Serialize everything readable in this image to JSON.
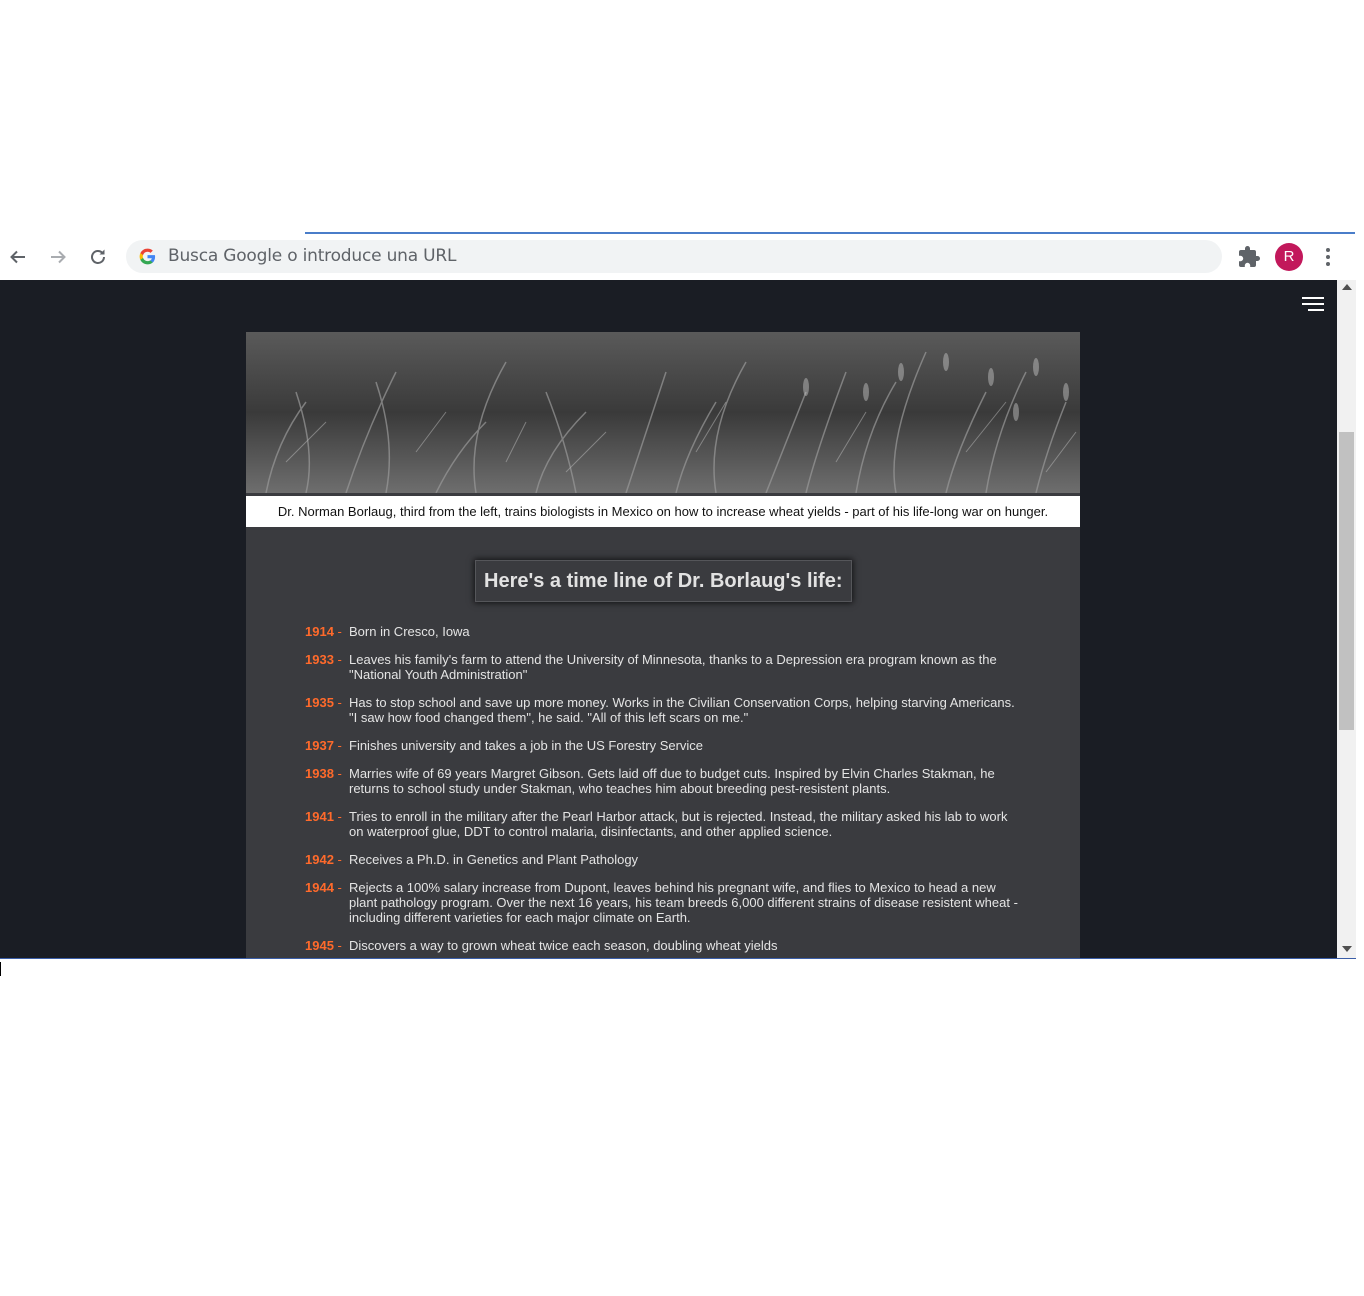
{
  "browser": {
    "omnibox_placeholder": "Busca Google o introduce una URL",
    "avatar_letter": "R",
    "accent_color": "#c2185b"
  },
  "page": {
    "caption": "Dr. Norman Borlaug, third from the left, trains biologists in Mexico on how to increase wheat yields - part of his life-long war on hunger.",
    "heading": "Here's a time line of Dr. Borlaug's life:",
    "year_color": "#ff6a2b",
    "events": [
      {
        "year": "1914",
        "text": "Born in Cresco, Iowa"
      },
      {
        "year": "1933",
        "text": "Leaves his family's farm to attend the University of Minnesota, thanks to a Depression era program known as the \"National Youth Administration\""
      },
      {
        "year": "1935",
        "text": "Has to stop school and save up more money. Works in the Civilian Conservation Corps, helping starving Americans. \"I saw how food changed them\", he said. \"All of this left scars on me.\""
      },
      {
        "year": "1937",
        "text": "Finishes university and takes a job in the US Forestry Service"
      },
      {
        "year": "1938",
        "text": "Marries wife of 69 years Margret Gibson. Gets laid off due to budget cuts. Inspired by Elvin Charles Stakman, he returns to school study under Stakman, who teaches him about breeding pest-resistent plants."
      },
      {
        "year": "1941",
        "text": "Tries to enroll in the military after the Pearl Harbor attack, but is rejected. Instead, the military asked his lab to work on waterproof glue, DDT to control malaria, disinfectants, and other applied science."
      },
      {
        "year": "1942",
        "text": "Receives a Ph.D. in Genetics and Plant Pathology"
      },
      {
        "year": "1944",
        "text": "Rejects a 100% salary increase from Dupont, leaves behind his pregnant wife, and flies to Mexico to head a new plant pathology program. Over the next 16 years, his team breeds 6,000 different strains of disease resistent wheat - including different varieties for each major climate on Earth."
      },
      {
        "year": "1945",
        "text": "Discovers a way to grown wheat twice each season, doubling wheat yields"
      }
    ]
  }
}
